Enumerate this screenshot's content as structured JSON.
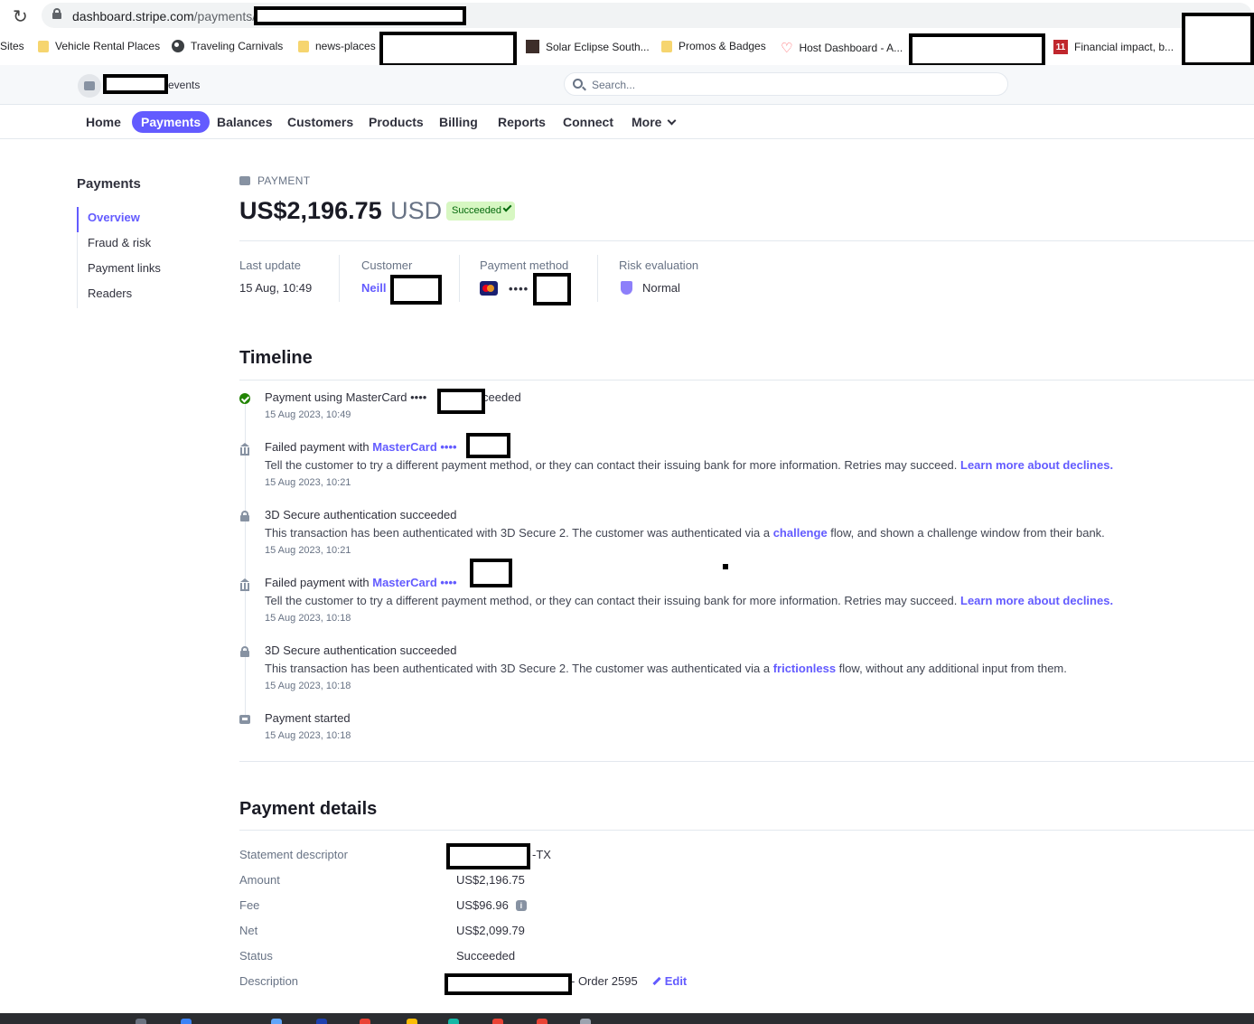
{
  "browser": {
    "url_host": "dashboard.stripe.com",
    "url_path": "/payments/",
    "bookmarks": [
      {
        "label": "Sites",
        "icon": "none"
      },
      {
        "label": "Vehicle Rental Places",
        "icon": "folder-icon"
      },
      {
        "label": "Traveling Carnivals",
        "icon": "globe-icon"
      },
      {
        "label": "news-places",
        "icon": "folder-icon"
      },
      {
        "label": "Solar Eclipse South...",
        "icon": "site-icon"
      },
      {
        "label": "Promos & Badges",
        "icon": "folder-icon"
      },
      {
        "label": "Host Dashboard - A...",
        "icon": "airbnb-icon"
      },
      {
        "label": "Financial impact, b...",
        "icon": "site-icon"
      }
    ]
  },
  "header": {
    "account_suffix": "events",
    "search_placeholder": "Search..."
  },
  "nav": {
    "items": [
      "Home",
      "Payments",
      "Balances",
      "Customers",
      "Products",
      "Billing",
      "Reports",
      "Connect",
      "More"
    ],
    "active": "Payments"
  },
  "sidebar": {
    "title": "Payments",
    "items": [
      "Overview",
      "Fraud & risk",
      "Payment links",
      "Readers"
    ],
    "active": "Overview"
  },
  "payment": {
    "kicker": "PAYMENT",
    "amount": "US$2,196.75",
    "currency": "USD",
    "status_badge": "Succeeded",
    "meta": {
      "last_update_label": "Last update",
      "last_update": "15 Aug, 10:49",
      "customer_label": "Customer",
      "customer": "Neill",
      "method_label": "Payment method",
      "method_dots": "••••",
      "risk_label": "Risk evaluation",
      "risk": "Normal"
    }
  },
  "timeline": {
    "title": "Timeline",
    "events": [
      {
        "icon": "check-circle-icon",
        "text": "Payment using MasterCard ••••",
        "text_after": "ucceeded",
        "time": "15 Aug 2023, 10:49"
      },
      {
        "icon": "bank-icon",
        "text": "Failed payment with ",
        "link": "MasterCard ••••",
        "desc": "Tell the customer to try a different payment method, or they can contact their issuing bank for more information. Retries may succeed. ",
        "desc_link": "Learn more about declines.",
        "time": "15 Aug 2023, 10:21"
      },
      {
        "icon": "lock-icon",
        "text": "3D Secure authentication succeeded",
        "desc_pre": "This transaction has been authenticated with 3D Secure 2. The customer was authenticated via a ",
        "desc_link": "challenge",
        "desc_post": " flow, and shown a challenge window from their bank.",
        "time": "15 Aug 2023, 10:21"
      },
      {
        "icon": "bank-icon",
        "text": "Failed payment with ",
        "link": "MasterCard ••••",
        "desc": "Tell the customer to try a different payment method, or they can contact their issuing bank for more information. Retries may succeed. ",
        "desc_link": "Learn more about declines.",
        "time": "15 Aug 2023, 10:18"
      },
      {
        "icon": "lock-icon",
        "text": "3D Secure authentication succeeded",
        "desc_pre": "This transaction has been authenticated with 3D Secure 2. The customer was authenticated via a ",
        "desc_link": "frictionless",
        "desc_post": " flow, without any additional input from them.",
        "time": "15 Aug 2023, 10:18"
      },
      {
        "icon": "payment-icon",
        "text": "Payment started",
        "time": "15 Aug 2023, 10:18"
      }
    ]
  },
  "details": {
    "title": "Payment details",
    "rows": [
      {
        "label": "Statement descriptor",
        "value": "-TX"
      },
      {
        "label": "Amount",
        "value": "US$2,196.75"
      },
      {
        "label": "Fee",
        "value": "US$96.96"
      },
      {
        "label": "Net",
        "value": "US$2,099.79"
      },
      {
        "label": "Status",
        "value": "Succeeded"
      },
      {
        "label": "Description",
        "value": "- Order 2595"
      }
    ],
    "edit_label": "Edit"
  },
  "colors": {
    "accent": "#635bff",
    "success_bg": "#d7f7c2",
    "success_text": "#05690d"
  }
}
